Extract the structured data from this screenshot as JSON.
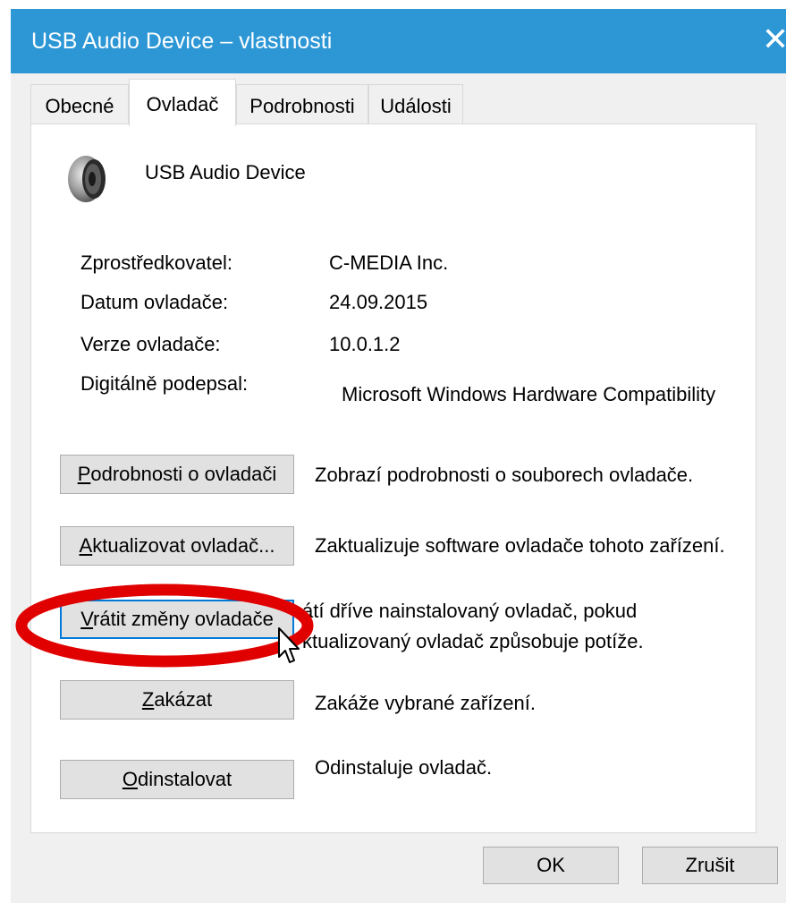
{
  "window": {
    "title": "USB Audio Device – vlastnosti",
    "close_symbol": "✕"
  },
  "tabs": [
    {
      "label": "Obecné",
      "active": false
    },
    {
      "label": "Ovladač",
      "active": true
    },
    {
      "label": "Podrobnosti",
      "active": false
    },
    {
      "label": "Události",
      "active": false
    }
  ],
  "device": {
    "icon": "speaker-icon",
    "name": "USB Audio Device"
  },
  "properties": {
    "provider_label": "Zprostředkovatel:",
    "provider_value": "C-MEDIA Inc.",
    "date_label": "Datum ovladače:",
    "date_value": "24.09.2015",
    "version_label": "Verze ovladače:",
    "version_value": "10.0.1.2",
    "signer_label": "Digitálně podepsal:",
    "signer_value": "Microsoft Windows Hardware Compatibility"
  },
  "actions": {
    "details": {
      "key": "P",
      "rest": "odrobnosti o ovladači",
      "description": "Zobrazí podrobnosti o souborech ovladače."
    },
    "update": {
      "key": "A",
      "rest": "ktualizovat ovladač...",
      "description": "Zaktualizuje software ovladače tohoto zařízení."
    },
    "rollback": {
      "key": "V",
      "rest": "rátit změny ovladače",
      "description_line1": "átí dříve nainstalovaný ovladač, pokud",
      "description_line2": "ktualizovaný ovladač způsobuje potíže."
    },
    "disable": {
      "key": "Z",
      "rest": "akázat",
      "description": "Zakáže vybrané zařízení."
    },
    "uninstall": {
      "key": "O",
      "rest": "dinstalovat",
      "description": "Odinstaluje ovladač."
    }
  },
  "footer": {
    "ok_label": "OK",
    "cancel_label": "Zrušit"
  },
  "colors": {
    "titlebar": "#2d97d6",
    "highlight_ellipse": "#e00000",
    "focus_border": "#0078d7"
  }
}
